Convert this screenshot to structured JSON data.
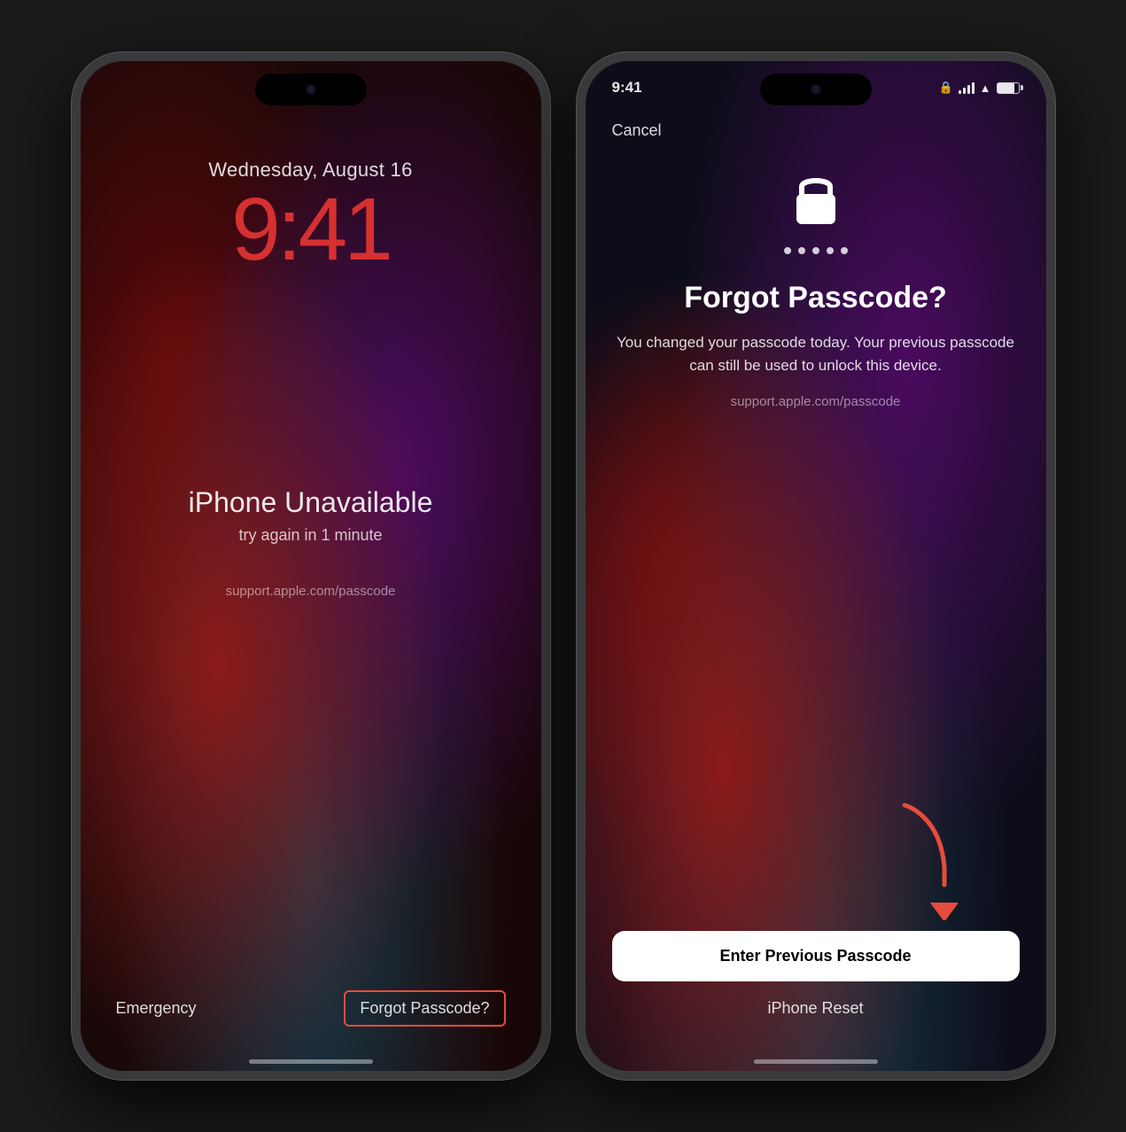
{
  "phone1": {
    "date": "Wednesday, August 16",
    "time": "9:41",
    "unavailable_title": "iPhone Unavailable",
    "unavailable_sub": "try again in 1 minute",
    "support_link": "support.apple.com/passcode",
    "emergency_label": "Emergency",
    "forgot_label": "Forgot Passcode?"
  },
  "phone2": {
    "status_time": "9:41",
    "cancel_label": "Cancel",
    "title": "Forgot Passcode?",
    "description": "You changed your passcode today. Your previous passcode can still be used to unlock this device.",
    "support_link": "support.apple.com/passcode",
    "enter_passcode_label": "Enter Previous Passcode",
    "iphone_reset_label": "iPhone Reset"
  },
  "icons": {
    "lock": "🔒",
    "lock_unicode": "&#xe637;"
  }
}
